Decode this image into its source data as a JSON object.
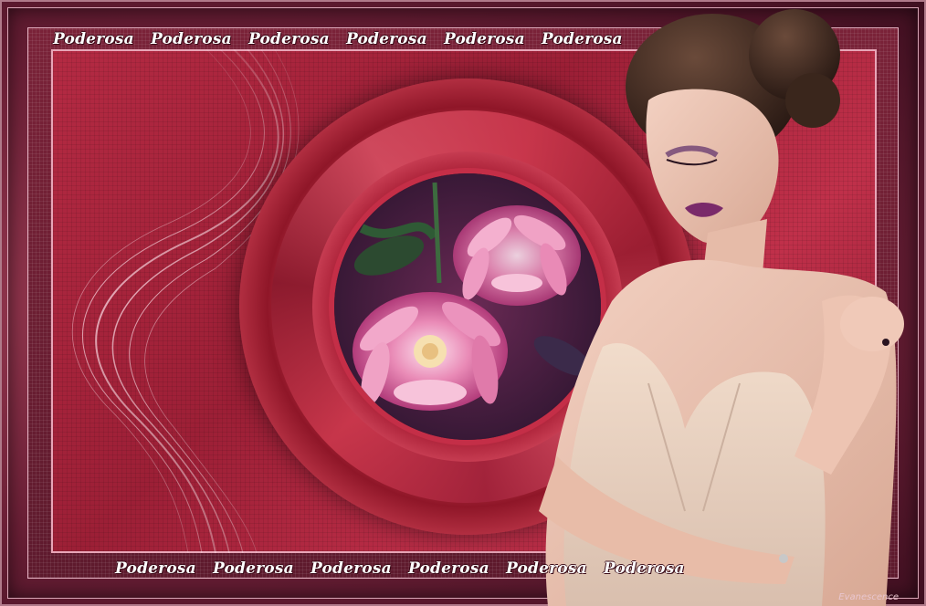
{
  "top_caption": [
    "Poderosa",
    "Poderosa",
    "Poderosa",
    "Poderosa",
    "Poderosa",
    "Poderosa"
  ],
  "bottom_caption": [
    "Poderosa",
    "Poderosa",
    "Poderosa",
    "Poderosa",
    "Poderosa",
    "Poderosa"
  ],
  "signature": "Evanescence",
  "colors": {
    "background": "#5a1a2e",
    "panel": "#b42a43",
    "ring": "#c8364b",
    "flower": "#e47aa8",
    "caption": "#ffffff"
  }
}
